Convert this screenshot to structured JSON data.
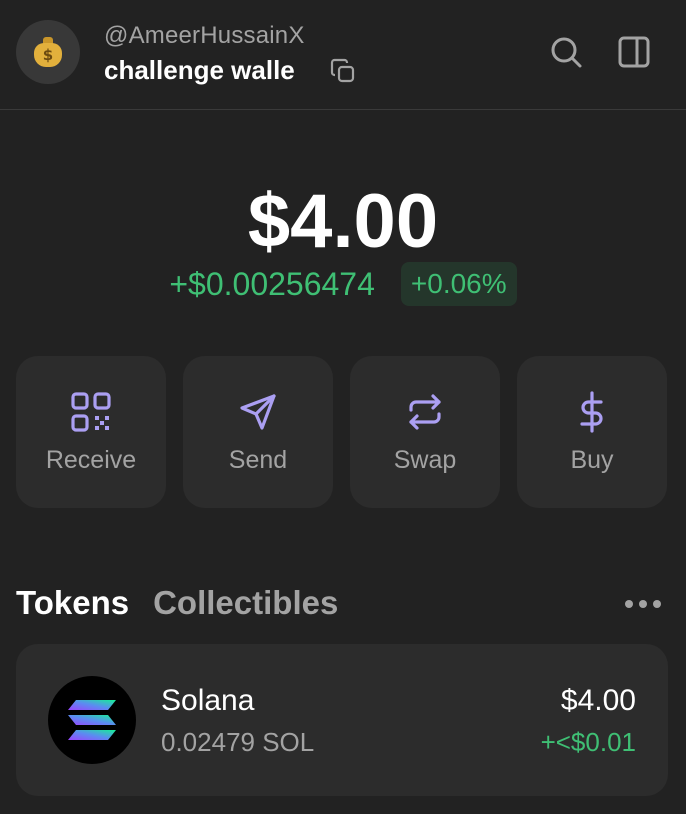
{
  "header": {
    "user_handle": "@AmeerHussainX",
    "wallet_name": "challenge walle",
    "avatar_icon": "money-bag-icon",
    "avatar_symbol": "$"
  },
  "balance": {
    "total": "$4.00",
    "change_amount": "+$0.00256474",
    "change_percent": "+0.06%"
  },
  "actions": [
    {
      "label": "Receive",
      "icon": "qr-code-icon"
    },
    {
      "label": "Send",
      "icon": "send-icon"
    },
    {
      "label": "Swap",
      "icon": "swap-icon"
    },
    {
      "label": "Buy",
      "icon": "dollar-icon"
    }
  ],
  "tabs": [
    {
      "label": "Tokens",
      "active": true
    },
    {
      "label": "Collectibles",
      "active": false
    }
  ],
  "tokens": [
    {
      "name": "Solana",
      "amount": "0.02479 SOL",
      "value": "$4.00",
      "change": "+<$0.01"
    }
  ],
  "colors": {
    "background": "#222222",
    "card": "#2c2c2c",
    "accent": "#ab9ff2",
    "positive": "#3fbf74",
    "muted": "#a3a3a3"
  }
}
